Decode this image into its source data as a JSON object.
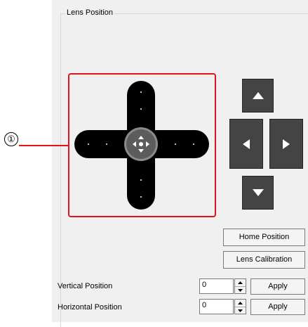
{
  "callout": {
    "number": "①"
  },
  "group": {
    "title": "Lens Position"
  },
  "joystick": {
    "center_icon": "move-arrows-icon"
  },
  "arrows": {
    "up": "arrow-up-icon",
    "left": "arrow-left-icon",
    "right": "arrow-right-icon",
    "down": "arrow-down-icon"
  },
  "buttons": {
    "home_position": "Home Position",
    "lens_calibration": "Lens Calibration"
  },
  "vertical": {
    "label": "Vertical Position",
    "value": "0",
    "apply": "Apply"
  },
  "horizontal": {
    "label": "Horizontal Position",
    "value": "0",
    "apply": "Apply"
  },
  "colors": {
    "highlight": "#e0141e",
    "button_dark": "#444444",
    "panel_bg": "#f0f0f0"
  }
}
